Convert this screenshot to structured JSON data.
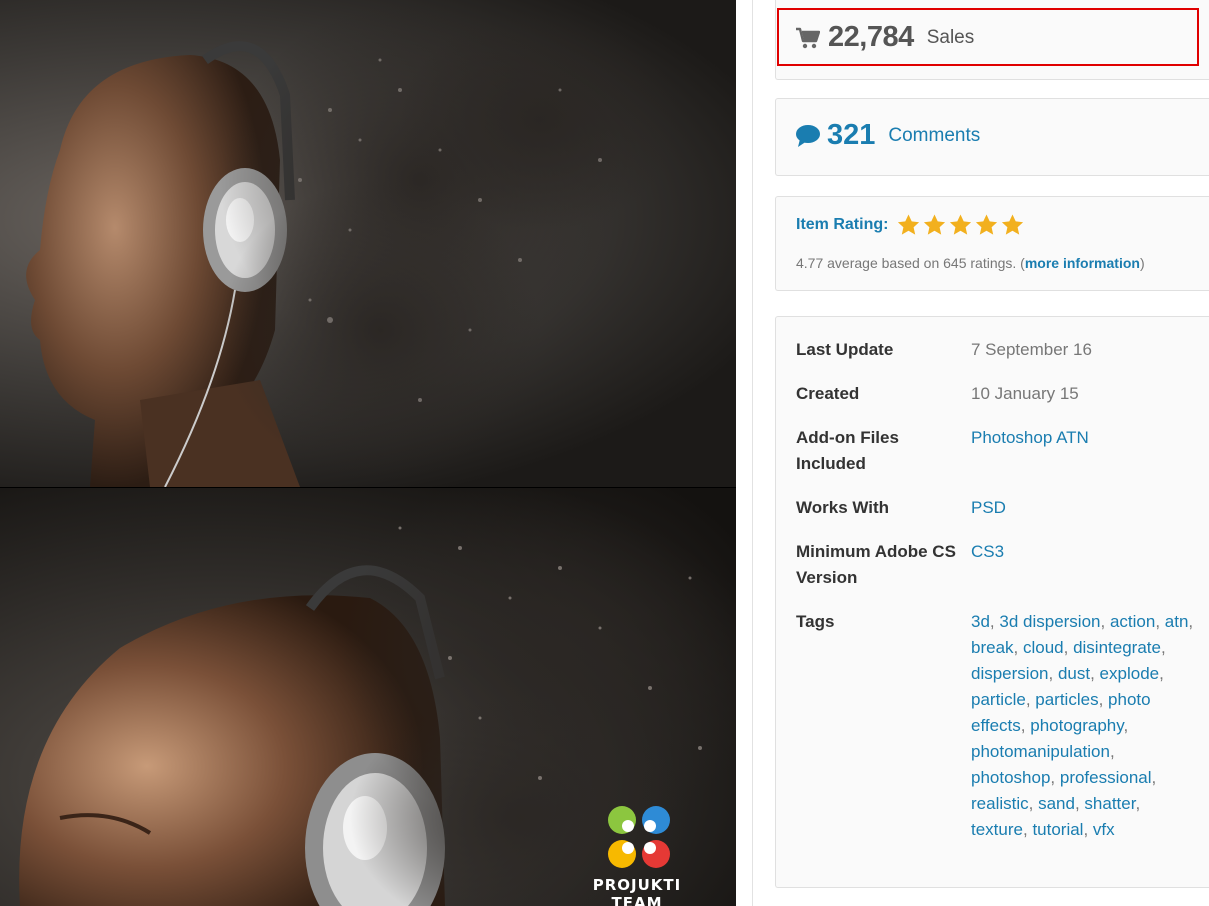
{
  "preview": {
    "watermark_text": "PROJUKTI TEAM"
  },
  "stats": {
    "sales_count": "22,784",
    "sales_label": "Sales",
    "comments_count": "321",
    "comments_label": "Comments"
  },
  "rating": {
    "label": "Item Rating:",
    "stars": 5,
    "star_color": "#f2b01e",
    "summary_prefix": "4.77 average based on 645 ratings. (",
    "more_link": "more information",
    "summary_suffix": ")"
  },
  "meta": {
    "last_update_key": "Last Update",
    "last_update_val": "7 September 16",
    "created_key": "Created",
    "created_val": "10 January 15",
    "addon_key": "Add-on Files Included",
    "addon_val": "Photoshop ATN",
    "works_key": "Works With",
    "works_val": "PSD",
    "min_key": "Minimum Adobe CS Version",
    "min_val": "CS3",
    "tags_key": "Tags",
    "tags": [
      "3d",
      "3d dispersion",
      "action",
      "atn",
      "break",
      "cloud",
      "disintegrate",
      "dispersion",
      "dust",
      "explode",
      "particle",
      "particles",
      "photo effects",
      "photography",
      "photomanipulation",
      "photoshop",
      "professional",
      "realistic",
      "sand",
      "shatter",
      "texture",
      "tutorial",
      "vfx"
    ]
  },
  "colors": {
    "link": "#1a7db0",
    "highlight_border": "#e00000"
  },
  "icons": {
    "cart": "cart-icon",
    "comments": "speech-bubble-icon",
    "star": "star-icon"
  }
}
